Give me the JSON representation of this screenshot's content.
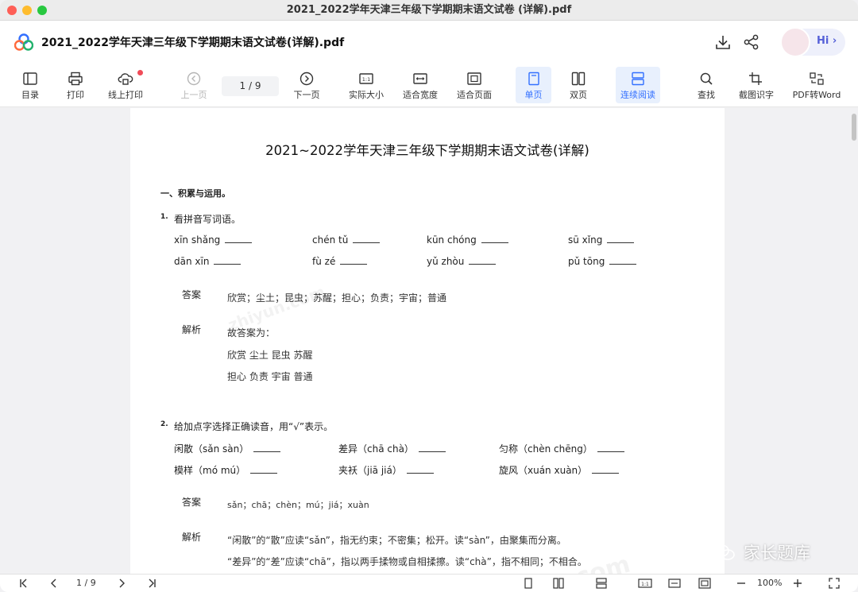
{
  "window": {
    "title": "2021_2022学年天津三年级下学期期末语文试卷 (详解).pdf"
  },
  "header": {
    "doc_title": "2021_2022学年天津三年级下学期期末语文试卷(详解).pdf",
    "hi_label": "Hi ›"
  },
  "toolbar": {
    "toc": "目录",
    "print": "打印",
    "online_print": "线上打印",
    "prev": "上一页",
    "page_indicator": "1 / 9",
    "next": "下一页",
    "actual_size": "实际大小",
    "fit_width": "适合宽度",
    "fit_page": "适合页面",
    "single": "单页",
    "double": "双页",
    "continuous": "连续阅读",
    "search": "查找",
    "ocr": "截图识字",
    "to_word": "PDF转Word"
  },
  "doc": {
    "title": "2021~2022学年天津三年级下学期期末语文试卷(详解)",
    "section1": "一、积累与运用。",
    "q1": {
      "num": "1.",
      "text": "看拼音写词语。",
      "items": [
        "xīn shǎng",
        "chén tǔ",
        "kūn chóng",
        "sū xǐng",
        "dān xīn",
        "fù zé",
        "yǔ zhòu",
        "pǔ tōng"
      ],
      "answer_tag": "答案",
      "answer": "欣赏；尘土；昆虫；苏醒；担心；负责；宇宙；普通",
      "explain_tag": "解析",
      "explain_1": "故答案为：",
      "explain_2": "欣赏 尘土 昆虫 苏醒",
      "explain_3": "担心 负责 宇宙 普通"
    },
    "q2": {
      "num": "2.",
      "text": "给加点字选择正确读音，用“√”表示。",
      "items": [
        "闲散（sǎn sàn）",
        "差异（chā chà）",
        "匀称（chèn chēng）",
        "模样（mó mú）",
        "夹袄（jiā jiá）",
        "旋风（xuán xuàn）"
      ],
      "answer_tag": "答案",
      "answer": "sǎn；chā；chèn；mú；jiá；xuàn",
      "explain_tag": "解析",
      "explain_1": "“闲散”的“散”应读“sǎn”，指无约束；不密集；松开。读“sàn”，由聚集而分离。",
      "explain_2": "“差异”的“差”应读“chā”，指以两手揉物或自相揉擦。读“chà”，指不相同；不相合。"
    },
    "watermark": "zhiyun.com"
  },
  "bottom": {
    "page_indicator": "1 / 9",
    "zoom": "100%"
  },
  "brand": "家长题库",
  "colors": {
    "accent": "#3370ff",
    "active_bg": "#e8f0fd",
    "red_dot": "#f04b58"
  }
}
